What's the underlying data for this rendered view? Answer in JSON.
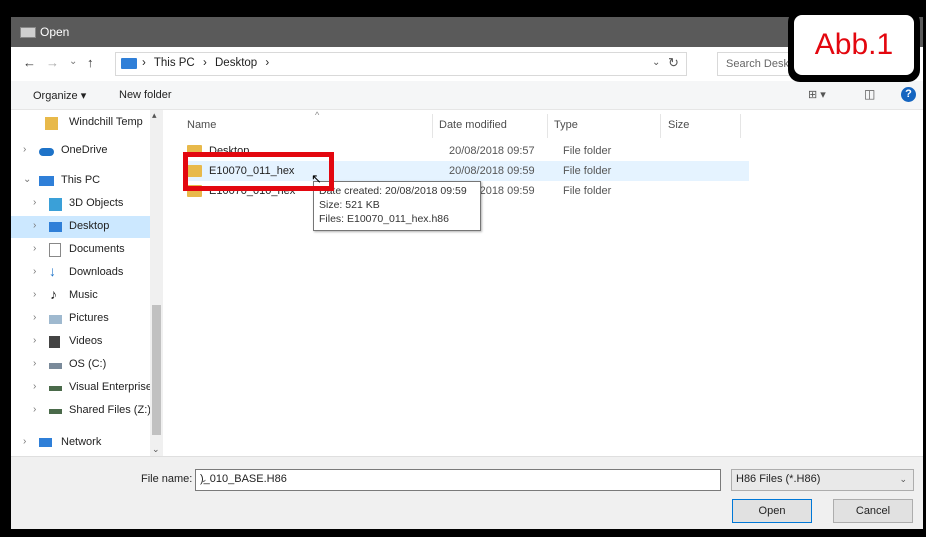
{
  "window": {
    "title": "Open"
  },
  "address": {
    "crumbs": [
      "This PC",
      "›",
      "Desktop",
      "›"
    ],
    "search_placeholder": "Search Desk",
    "nav": {
      "back": "←",
      "forward": "→",
      "recent": "⌄",
      "up": "↑",
      "refresh": "↻",
      "dropdown": "⌄"
    }
  },
  "toolbar": {
    "organize": "Organize ▾",
    "new_folder": "New folder",
    "view": "⊞ ▾",
    "preview": "◫",
    "help": "?"
  },
  "nav_pane": {
    "items": [
      {
        "label": "Windchill Temp",
        "chev": "",
        "icon": "folder-icon"
      },
      {
        "label": "OneDrive",
        "chev": "›",
        "icon": "cloud-icon"
      },
      {
        "label": "This PC",
        "chev": "⌄",
        "icon": "pc-icon"
      },
      {
        "label": "3D Objects",
        "chev": "›",
        "icon": "cube-icon"
      },
      {
        "label": "Desktop",
        "chev": "›",
        "icon": "desktop-icon"
      },
      {
        "label": "Documents",
        "chev": "›",
        "icon": "document-icon"
      },
      {
        "label": "Downloads",
        "chev": "›",
        "icon": "download-icon"
      },
      {
        "label": "Music",
        "chev": "›",
        "icon": "music-icon"
      },
      {
        "label": "Pictures",
        "chev": "›",
        "icon": "picture-icon"
      },
      {
        "label": "Videos",
        "chev": "›",
        "icon": "video-icon"
      },
      {
        "label": "OS (C:)",
        "chev": "›",
        "icon": "drive-icon"
      },
      {
        "label": "Visual Enterprise",
        "chev": "›",
        "icon": "network-drive-icon"
      },
      {
        "label": "Shared Files (Z:)",
        "chev": "›",
        "icon": "network-drive-icon"
      },
      {
        "label": "Network",
        "chev": "›",
        "icon": "network-icon"
      }
    ]
  },
  "columns": {
    "name": "Name",
    "date": "Date modified",
    "type": "Type",
    "size": "Size"
  },
  "files": [
    {
      "name": "Desktop",
      "date": "20/08/2018 09:57",
      "type": "File folder"
    },
    {
      "name": "E10070_011_hex",
      "date": "20/08/2018 09:59",
      "type": "File folder"
    },
    {
      "name": "E10070_010_hex",
      "date": "20/08/2018 09:59",
      "type": "File folder"
    }
  ],
  "tooltip": {
    "created": "Date created: 20/08/2018 09:59",
    "size": "Size: 521 KB",
    "files": "Files: E10070_011_hex.h86"
  },
  "bottom": {
    "file_name_label": "File name:",
    "file_name_value": ")_010_BASE.H86",
    "filter": "H86 Files (*.H86)",
    "open": "Open",
    "cancel": "Cancel"
  },
  "annotation": {
    "label": "Abb.1"
  },
  "colors": {
    "highlight": "#e3070f",
    "selection": "#cce8ff",
    "folder": "#e8b94a"
  }
}
